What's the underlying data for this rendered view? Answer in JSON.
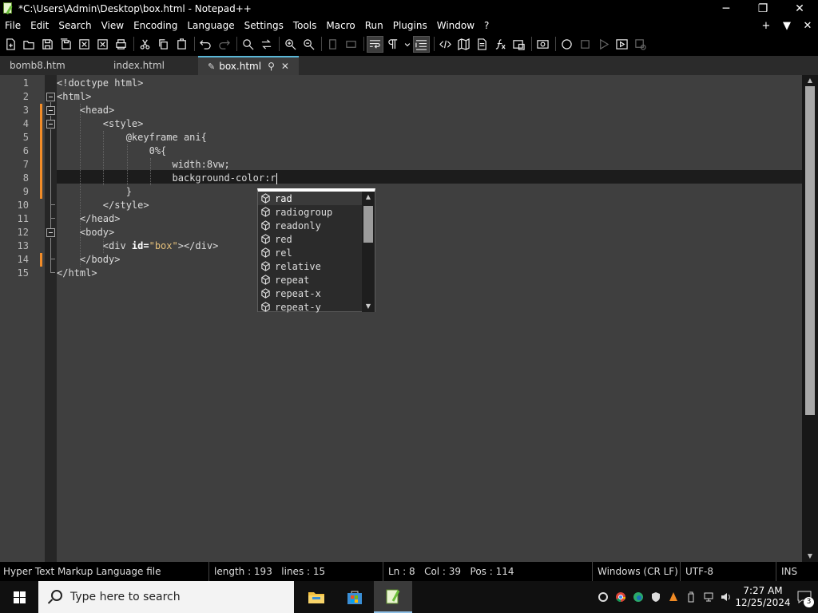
{
  "window": {
    "title": "*C:\\Users\\Admin\\Desktop\\box.html - Notepad++",
    "minimize": "─",
    "maximize": "❐",
    "close": "✕"
  },
  "menu": {
    "items": [
      "File",
      "Edit",
      "Search",
      "View",
      "Encoding",
      "Language",
      "Settings",
      "Tools",
      "Macro",
      "Run",
      "Plugins",
      "Window",
      "?"
    ],
    "right": [
      "+",
      "▼",
      "✕"
    ]
  },
  "tabs": [
    {
      "label": "bomb8.htm",
      "active": false
    },
    {
      "label": "index.html",
      "active": false
    },
    {
      "label": "box.html",
      "active": true
    }
  ],
  "editor": {
    "line_numbers": [
      "1",
      "2",
      "3",
      "4",
      "5",
      "6",
      "7",
      "8",
      "9",
      "10",
      "11",
      "12",
      "13",
      "14",
      "15"
    ],
    "lines": [
      "<!doctype html>",
      "<html>",
      "    <head>",
      "        <style>",
      "            @keyframe ani{",
      "                0%{",
      "                    width:8vw;",
      "                    background-color:r",
      "            }",
      "        </style>",
      "    </head>",
      "    <body>",
      "        <div id=\"box\"></div>",
      "    </body>",
      "</html>"
    ],
    "line13": {
      "indent": "        ",
      "open": "<div ",
      "attr": "id=",
      "value": "\"box\"",
      "close": "></div>"
    }
  },
  "autocomplete": {
    "items": [
      "rad",
      "radiogroup",
      "readonly",
      "red",
      "rel",
      "relative",
      "repeat",
      "repeat-x",
      "repeat-y"
    ],
    "selected": "rad"
  },
  "status": {
    "file_type": "Hyper Text Markup Language file",
    "length": "length : 193",
    "lines": "lines : 15",
    "ln": "Ln : 8",
    "col": "Col : 39",
    "pos": "Pos : 114",
    "eol": "Windows (CR LF)",
    "encoding": "UTF-8",
    "mode": "INS"
  },
  "taskbar": {
    "search_placeholder": "Type here to search",
    "time": "7:27 AM",
    "date": "12/25/2024",
    "notifications": "3"
  },
  "colors": {
    "editor_bg": "#3f3f3f",
    "current_line": "#1c1c1c",
    "change_marker": "#f28c28",
    "active_tab_accent": "#5ab6d6"
  }
}
